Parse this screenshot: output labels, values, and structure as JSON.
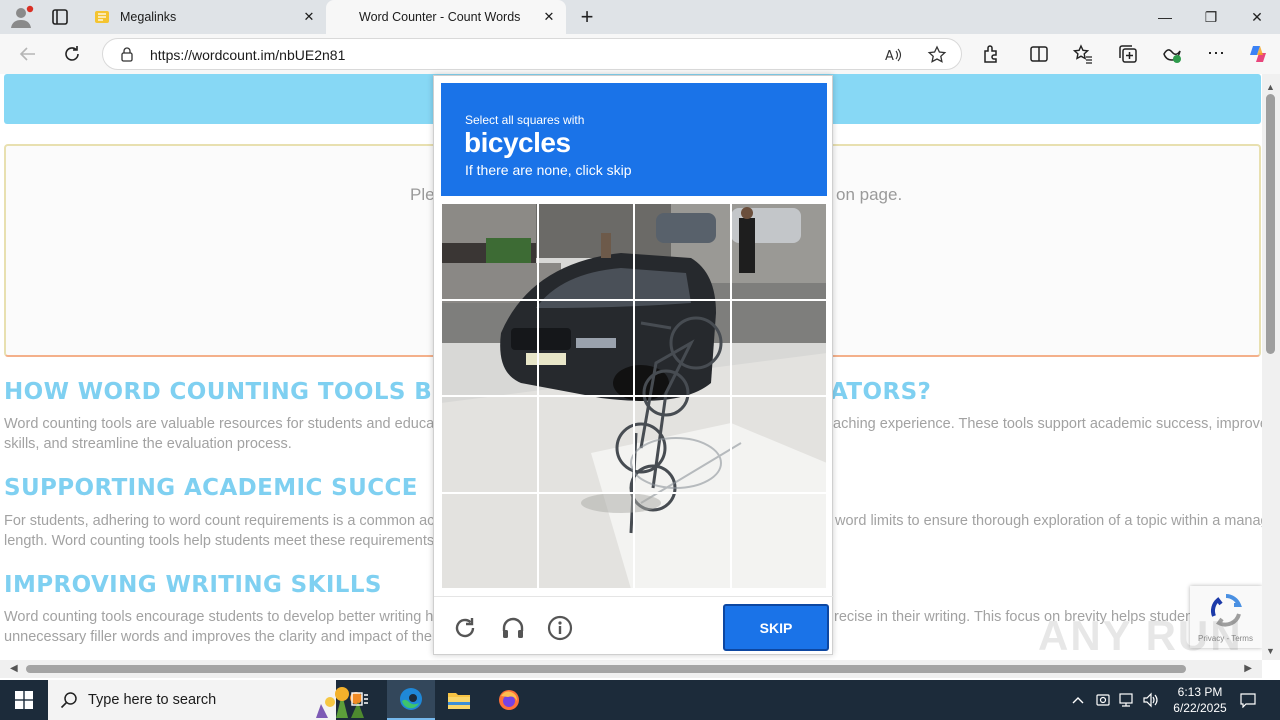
{
  "browser": {
    "tabs": [
      {
        "title": "Megalinks"
      },
      {
        "title": "Word Counter - Count Words"
      }
    ],
    "url_scheme": "https://",
    "url_host": "wordcount.im",
    "url_path": "/nbUE2n81"
  },
  "page": {
    "notice_left": "Ple",
    "notice_right": "on page.",
    "headings": [
      {
        "left": "HOW WORD COUNTING TOOLS B",
        "right": "ATORS?"
      },
      {
        "left": "SUPPORTING ACADEMIC SUCCE",
        "right": ""
      },
      {
        "left": "IMPROVING WRITING SKILLS",
        "right": ""
      }
    ],
    "paragraphs": [
      {
        "left": "Word counting tools are valuable resources for students and educator",
        "right": "aching experience. These tools support academic success, improve w",
        "line2": "skills, and streamline the evaluation process."
      },
      {
        "left": "For students, adhering to word count requirements is a common acad",
        "right": "word limits to ensure thorough exploration of a topic within a manage",
        "line2": "length. Word counting tools help students meet these requirements, e"
      },
      {
        "left": "Word counting tools encourage students to develop better writing hab",
        "right": "recise in their writing. This focus on brevity helps students",
        "line2": "unnecessary filler words and improves the clarity and impact of their v"
      }
    ]
  },
  "captcha": {
    "instruction": "Select all squares with",
    "target": "bicycles",
    "hint": "If there are none, click skip",
    "skip_label": "SKIP"
  },
  "recaptcha_badge": {
    "terms": "Privacy - Terms"
  },
  "watermark": "ANY RUN",
  "taskbar": {
    "search_placeholder": "Type here to search",
    "time": "6:13 PM",
    "date": "6/22/2025"
  },
  "colors": {
    "captcha_blue": "#1a73e8",
    "heading_blue": "#7fd0f1",
    "top_band": "#87d8f5",
    "taskbar": "#1c2b3a"
  }
}
